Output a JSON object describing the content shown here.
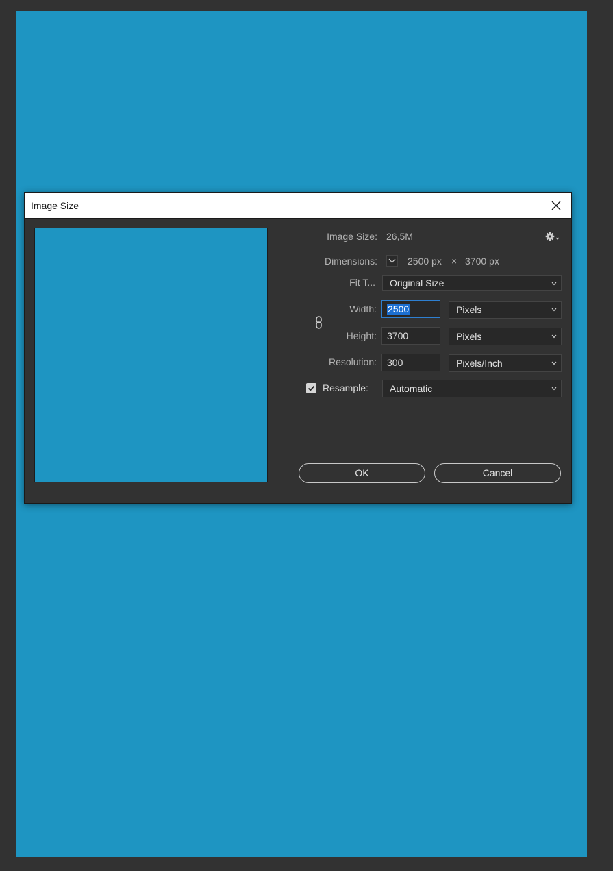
{
  "dialog": {
    "title": "Image Size"
  },
  "info": {
    "image_size_label": "Image Size:",
    "image_size_value": "26,5M",
    "dimensions_label": "Dimensions:",
    "dimensions_width": "2500 px",
    "dimensions_separator": "×",
    "dimensions_height": "3700 px"
  },
  "fit_to": {
    "label": "Fit T...",
    "value": "Original Size"
  },
  "width": {
    "label": "Width:",
    "value": "2500",
    "unit": "Pixels"
  },
  "height": {
    "label": "Height:",
    "value": "3700",
    "unit": "Pixels"
  },
  "resolution": {
    "label": "Resolution:",
    "value": "300",
    "unit": "Pixels/Inch"
  },
  "resample": {
    "label": "Resample:",
    "checked": true,
    "value": "Automatic"
  },
  "buttons": {
    "ok": "OK",
    "cancel": "Cancel"
  },
  "colors": {
    "document_fill": "#1e95c2",
    "dialog_bg": "#323232",
    "focus_border": "#2e7fd0"
  },
  "icons": {
    "close": "close-icon",
    "gear": "gear-icon",
    "link": "link-chain-icon",
    "dimensions_toggle": "chevron-down-icon",
    "checkbox": "checkmark-icon"
  }
}
